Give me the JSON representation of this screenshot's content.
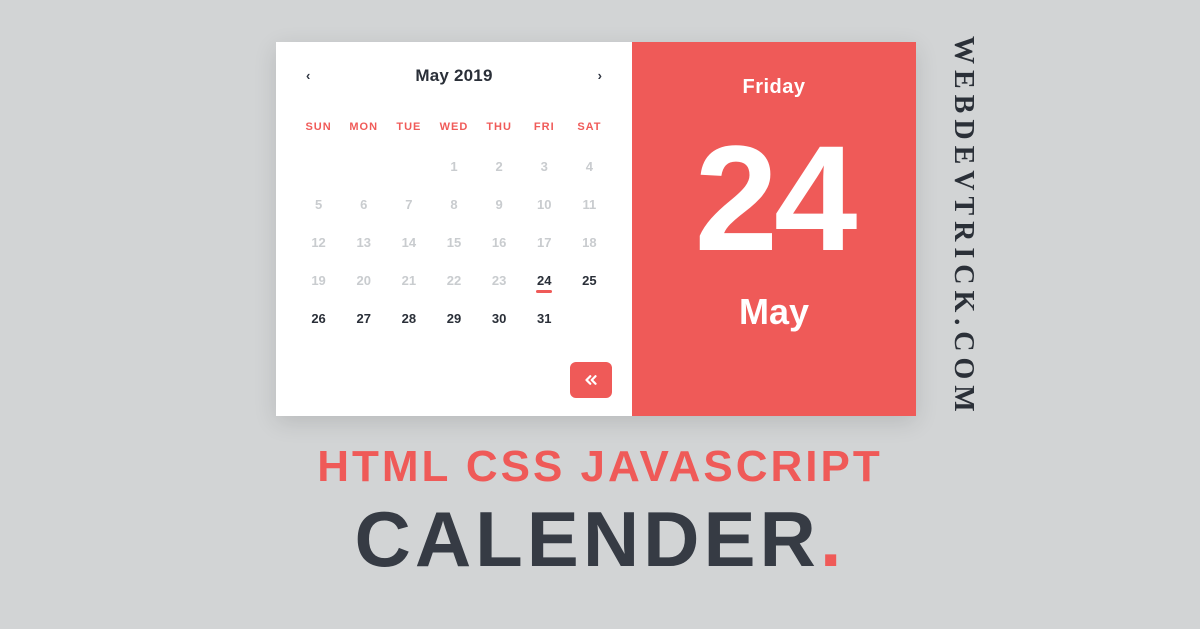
{
  "colors": {
    "accent": "#ef5a58",
    "text": "#2a2f38",
    "muted": "#c9cccf",
    "bg": "#d2d4d5"
  },
  "brand": "WEBDEVTRICK.COM",
  "headline": {
    "line1": "HTML CSS JAVASCRIPT",
    "line2": "CALENDER",
    "dot": "."
  },
  "calendar": {
    "title": "May 2019",
    "nav_prev": "‹",
    "nav_next": "›",
    "dow": [
      "SUN",
      "MON",
      "TUE",
      "WED",
      "THU",
      "FRI",
      "SAT"
    ],
    "weeks": [
      [
        {
          "n": "",
          "t": "blank"
        },
        {
          "n": "",
          "t": "blank"
        },
        {
          "n": "",
          "t": "blank"
        },
        {
          "n": "1",
          "t": "light"
        },
        {
          "n": "2",
          "t": "light"
        },
        {
          "n": "3",
          "t": "light"
        },
        {
          "n": "4",
          "t": "light"
        }
      ],
      [
        {
          "n": "5",
          "t": "light"
        },
        {
          "n": "6",
          "t": "light"
        },
        {
          "n": "7",
          "t": "light"
        },
        {
          "n": "8",
          "t": "light"
        },
        {
          "n": "9",
          "t": "light"
        },
        {
          "n": "10",
          "t": "light"
        },
        {
          "n": "11",
          "t": "light"
        }
      ],
      [
        {
          "n": "12",
          "t": "light"
        },
        {
          "n": "13",
          "t": "light"
        },
        {
          "n": "14",
          "t": "light"
        },
        {
          "n": "15",
          "t": "light"
        },
        {
          "n": "16",
          "t": "light"
        },
        {
          "n": "17",
          "t": "light"
        },
        {
          "n": "18",
          "t": "light"
        }
      ],
      [
        {
          "n": "19",
          "t": "light"
        },
        {
          "n": "20",
          "t": "light"
        },
        {
          "n": "21",
          "t": "light"
        },
        {
          "n": "22",
          "t": "light"
        },
        {
          "n": "23",
          "t": "light"
        },
        {
          "n": "24",
          "t": "sel"
        },
        {
          "n": "25",
          "t": "dark"
        }
      ],
      [
        {
          "n": "26",
          "t": "dark"
        },
        {
          "n": "27",
          "t": "dark"
        },
        {
          "n": "28",
          "t": "dark"
        },
        {
          "n": "29",
          "t": "dark"
        },
        {
          "n": "30",
          "t": "dark"
        },
        {
          "n": "31",
          "t": "dark"
        },
        {
          "n": "",
          "t": "blank"
        }
      ]
    ],
    "selected": {
      "weekday": "Friday",
      "day": "24",
      "month": "May"
    },
    "toggle_icon": "double-chevron-left"
  }
}
